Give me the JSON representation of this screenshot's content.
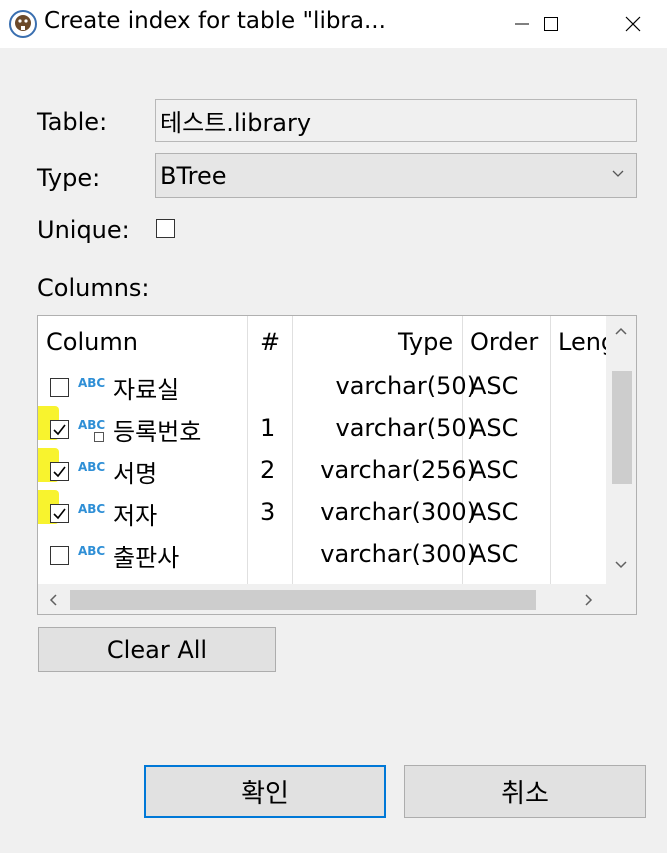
{
  "window": {
    "title": "Create index for table \"libra...",
    "icon": "dbeaver-beaver-icon",
    "controls": [
      "minimize-icon",
      "maximize-icon",
      "close-icon"
    ]
  },
  "form": {
    "table_label": "Table:",
    "table_value": "테스트.library",
    "type_label": "Type:",
    "type_value": "BTree",
    "unique_label": "Unique:",
    "unique_checked": false,
    "columns_label": "Columns:"
  },
  "grid": {
    "headers": [
      "Column",
      "#",
      "Type",
      "Order",
      "Leng"
    ],
    "rows": [
      {
        "checked": false,
        "icon": "ABC",
        "name": "자료실",
        "num": "",
        "type": "varchar(50)",
        "order": "ASC",
        "highlighted": false
      },
      {
        "checked": true,
        "icon": "ABC",
        "name": "등록번호",
        "num": "1",
        "type": "varchar(50)",
        "order": "ASC",
        "highlighted": true,
        "key_overlay": true
      },
      {
        "checked": true,
        "icon": "ABC",
        "name": "서명",
        "num": "2",
        "type": "varchar(256)",
        "order": "ASC",
        "highlighted": true
      },
      {
        "checked": true,
        "icon": "ABC",
        "name": "저자",
        "num": "3",
        "type": "varchar(300)",
        "order": "ASC",
        "highlighted": true
      },
      {
        "checked": false,
        "icon": "ABC",
        "name": "출판사",
        "num": "",
        "type": "varchar(300)",
        "order": "ASC",
        "highlighted": false
      }
    ]
  },
  "buttons": {
    "clear_all": "Clear All",
    "ok": "확인",
    "cancel": "취소"
  },
  "colors": {
    "highlight": "#f8f32e",
    "type_icon": "#2f8fd6",
    "ok_border": "#0078d7"
  }
}
